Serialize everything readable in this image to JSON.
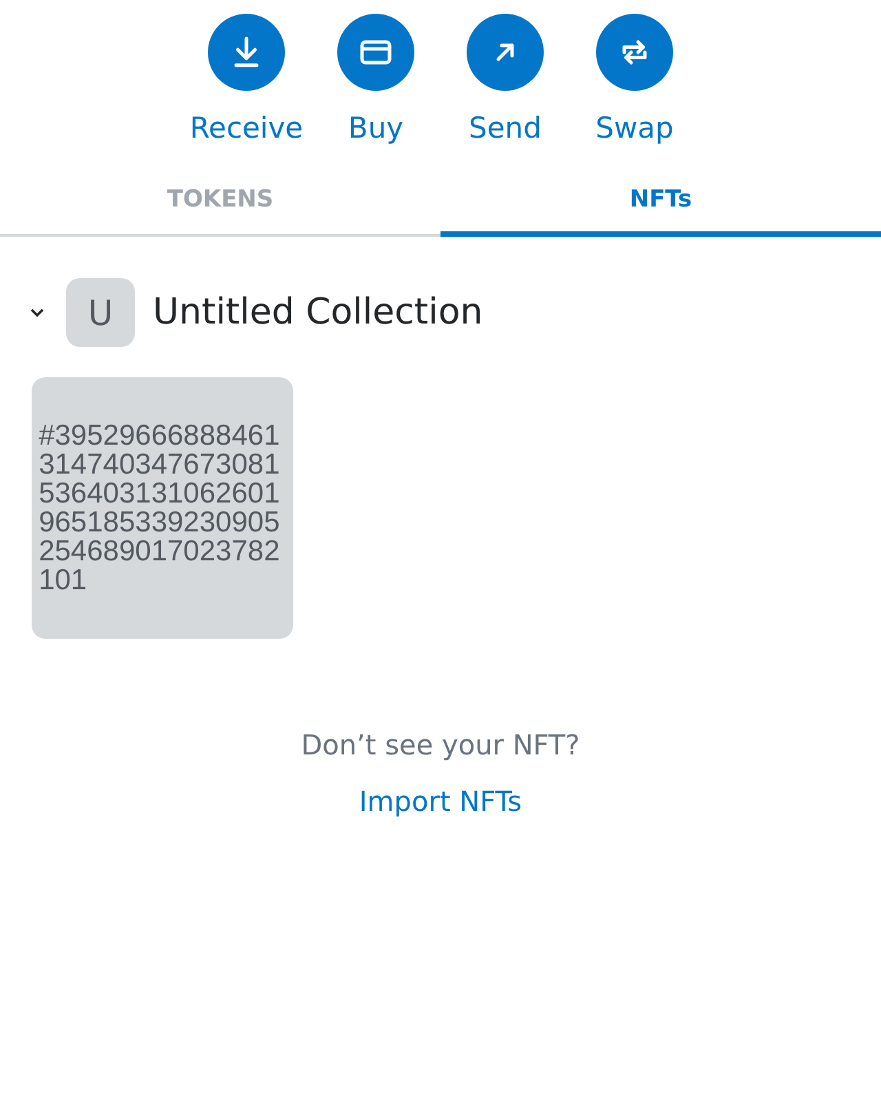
{
  "actions": [
    {
      "kind": "receive",
      "label": "Receive"
    },
    {
      "kind": "buy",
      "label": "Buy"
    },
    {
      "kind": "send",
      "label": "Send"
    },
    {
      "kind": "swap",
      "label": "Swap"
    }
  ],
  "tabs": [
    {
      "label": "TOKENS",
      "selected": false
    },
    {
      "label": "NFTs",
      "selected": true
    }
  ],
  "collection": {
    "expanded": true,
    "initial": "U",
    "name": "Untitled Collection",
    "items": [
      {
        "title": "#39529666888461314740347673081536403131062601965185339230905254689017023782101"
      }
    ]
  },
  "footer": {
    "prompt": "Don’t see your NFT?",
    "link": "Import NFTs"
  }
}
